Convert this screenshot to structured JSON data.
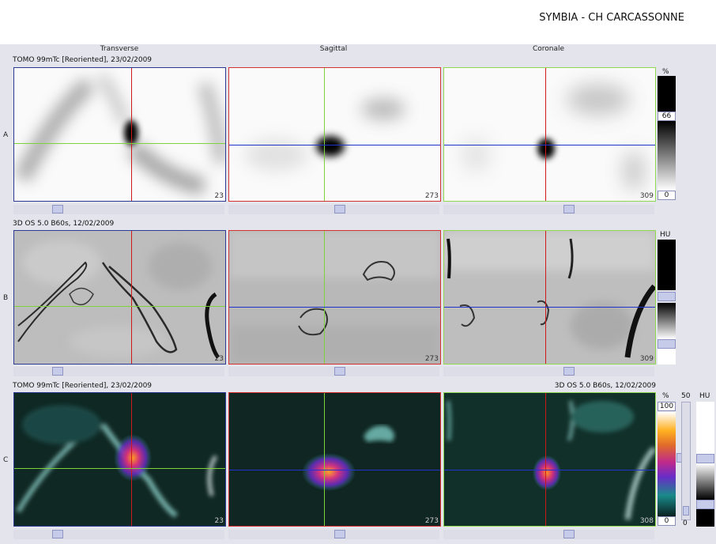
{
  "header": {
    "title": "SYMBIA - CH CARCASSONNE"
  },
  "columns": [
    "Transverse",
    "Sagittal",
    "Coronale"
  ],
  "rows": [
    {
      "letter": "A",
      "info": "TOMO 99mTc [Reoriented], 23/02/2009",
      "info_right": ""
    },
    {
      "letter": "B",
      "info": "3D  OS  5.0  B60s, 12/02/2009",
      "info_right": ""
    },
    {
      "letter": "C",
      "info": "TOMO 99mTc [Reoriented], 23/02/2009",
      "info_right": "3D  OS  5.0  B60s, 12/02/2009"
    }
  ],
  "slices": [
    "23",
    "273",
    "309"
  ],
  "slices_c": [
    "23",
    "273",
    "308"
  ],
  "colorbar_a": {
    "unit": "%",
    "value": "66",
    "min": "0"
  },
  "colorbar_b": {
    "unit": "HU"
  },
  "colorbar_c": {
    "unit": "%",
    "max": "100",
    "min": "0",
    "ct_top": "50",
    "ct_unit": "HU",
    "ct_min": "0"
  },
  "colors": {
    "red": "#cc1a1a",
    "green": "#7ed23a",
    "blue": "#2233cc",
    "border_transverse": "#2b3a94",
    "border_sagittal": "#d63030",
    "border_coronal": "#90d850"
  }
}
